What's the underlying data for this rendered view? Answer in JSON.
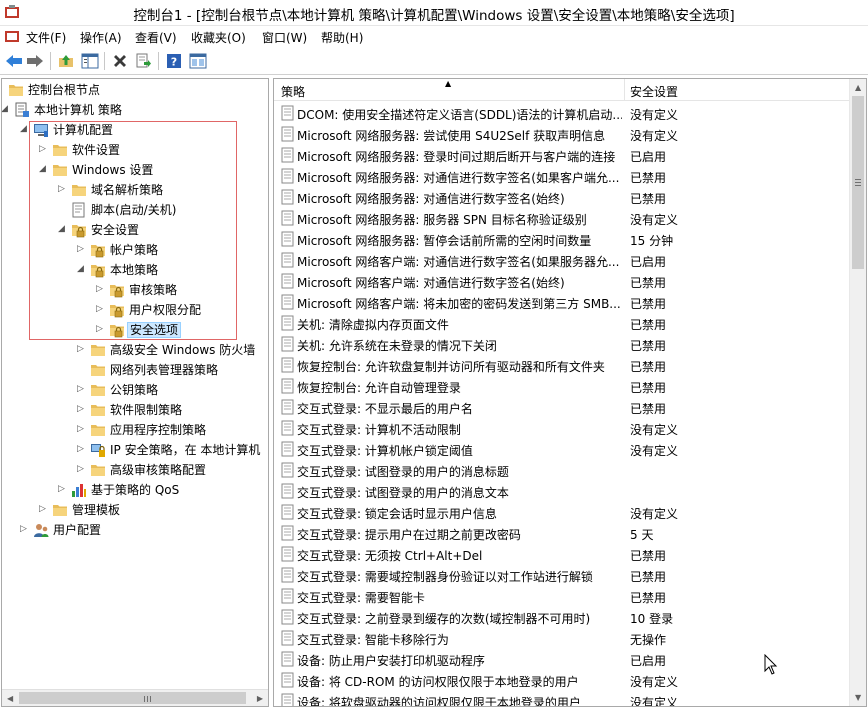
{
  "window": {
    "title": "控制台1 - [控制台根节点\\本地计算机 策略\\计算机配置\\Windows 设置\\安全设置\\本地策略\\安全选项]"
  },
  "menu": [
    "文件(F)",
    "操作(A)",
    "查看(V)",
    "收藏夹(O)",
    "窗口(W)",
    "帮助(H)"
  ],
  "toolbar": {
    "icons": [
      "back-arrow-icon",
      "forward-arrow-icon",
      "up-folder-icon",
      "show-hide-tree-icon",
      "delete-icon",
      "export-list-icon",
      "help-icon",
      "properties-icon"
    ]
  },
  "tree": [
    {
      "label": "控制台根节点",
      "icon": "folder-icon",
      "expander": ""
    },
    {
      "label": "本地计算机 策略",
      "icon": "policy-icon",
      "expander": "open"
    },
    {
      "label": "计算机配置",
      "icon": "computer-icon",
      "expander": "open"
    },
    {
      "label": "软件设置",
      "icon": "folder-icon",
      "expander": "closed"
    },
    {
      "label": "Windows 设置",
      "icon": "folder-icon",
      "expander": "open"
    },
    {
      "label": "域名解析策略",
      "icon": "folder-icon",
      "expander": "closed"
    },
    {
      "label": "脚本(启动/关机)",
      "icon": "script-icon",
      "expander": ""
    },
    {
      "label": "安全设置",
      "icon": "lock-folder-icon",
      "expander": "open"
    },
    {
      "label": "帐户策略",
      "icon": "lock-folder-icon",
      "expander": "closed"
    },
    {
      "label": "本地策略",
      "icon": "lock-folder-icon",
      "expander": "open"
    },
    {
      "label": "审核策略",
      "icon": "lock-folder-icon",
      "expander": "closed"
    },
    {
      "label": "用户权限分配",
      "icon": "lock-folder-icon",
      "expander": "closed"
    },
    {
      "label": "安全选项",
      "icon": "lock-folder-icon",
      "expander": "closed"
    },
    {
      "label": "高级安全 Windows 防火墙",
      "icon": "folder-icon",
      "expander": "closed"
    },
    {
      "label": "网络列表管理器策略",
      "icon": "folder-icon",
      "expander": ""
    },
    {
      "label": "公钥策略",
      "icon": "folder-icon",
      "expander": "closed"
    },
    {
      "label": "软件限制策略",
      "icon": "folder-icon",
      "expander": "closed"
    },
    {
      "label": "应用程序控制策略",
      "icon": "folder-icon",
      "expander": "closed"
    },
    {
      "label": "IP 安全策略，在 本地计算机",
      "icon": "ipsec-icon",
      "expander": "closed"
    },
    {
      "label": "高级审核策略配置",
      "icon": "folder-icon",
      "expander": "closed"
    },
    {
      "label": "基于策略的 QoS",
      "icon": "chart-icon",
      "expander": "closed"
    },
    {
      "label": "管理模板",
      "icon": "folder-icon",
      "expander": "closed"
    },
    {
      "label": "用户配置",
      "icon": "user-icon",
      "expander": "closed"
    }
  ],
  "table": {
    "columns": [
      "策略",
      "安全设置"
    ],
    "rows": [
      {
        "policy": "DCOM: 使用安全描述符定义语言(SDDL)语法的计算机启动...",
        "setting": "没有定义"
      },
      {
        "policy": "Microsoft 网络服务器: 尝试使用 S4U2Self 获取声明信息",
        "setting": "没有定义"
      },
      {
        "policy": "Microsoft 网络服务器: 登录时间过期后断开与客户端的连接",
        "setting": "已启用"
      },
      {
        "policy": "Microsoft 网络服务器: 对通信进行数字签名(如果客户端允...",
        "setting": "已禁用"
      },
      {
        "policy": "Microsoft 网络服务器: 对通信进行数字签名(始终)",
        "setting": "已禁用"
      },
      {
        "policy": "Microsoft 网络服务器: 服务器 SPN 目标名称验证级别",
        "setting": "没有定义"
      },
      {
        "policy": "Microsoft 网络服务器: 暂停会话前所需的空闲时间数量",
        "setting": "15 分钟"
      },
      {
        "policy": "Microsoft 网络客户端: 对通信进行数字签名(如果服务器允...",
        "setting": "已启用"
      },
      {
        "policy": "Microsoft 网络客户端: 对通信进行数字签名(始终)",
        "setting": "已禁用"
      },
      {
        "policy": "Microsoft 网络客户端: 将未加密的密码发送到第三方 SMB...",
        "setting": "已禁用"
      },
      {
        "policy": "关机: 清除虚拟内存页面文件",
        "setting": "已禁用"
      },
      {
        "policy": "关机: 允许系统在未登录的情况下关闭",
        "setting": "已禁用"
      },
      {
        "policy": "恢复控制台: 允许软盘复制并访问所有驱动器和所有文件夹",
        "setting": "已禁用"
      },
      {
        "policy": "恢复控制台: 允许自动管理登录",
        "setting": "已禁用"
      },
      {
        "policy": "交互式登录: 不显示最后的用户名",
        "setting": "已禁用"
      },
      {
        "policy": "交互式登录: 计算机不活动限制",
        "setting": "没有定义"
      },
      {
        "policy": "交互式登录: 计算机帐户锁定阈值",
        "setting": "没有定义"
      },
      {
        "policy": "交互式登录: 试图登录的用户的消息标题",
        "setting": ""
      },
      {
        "policy": "交互式登录: 试图登录的用户的消息文本",
        "setting": ""
      },
      {
        "policy": "交互式登录: 锁定会话时显示用户信息",
        "setting": "没有定义"
      },
      {
        "policy": "交互式登录: 提示用户在过期之前更改密码",
        "setting": "5 天"
      },
      {
        "policy": "交互式登录: 无须按 Ctrl+Alt+Del",
        "setting": "已禁用"
      },
      {
        "policy": "交互式登录: 需要域控制器身份验证以对工作站进行解锁",
        "setting": "已禁用"
      },
      {
        "policy": "交互式登录: 需要智能卡",
        "setting": "已禁用"
      },
      {
        "policy": "交互式登录: 之前登录到缓存的次数(域控制器不可用时)",
        "setting": "10 登录"
      },
      {
        "policy": "交互式登录: 智能卡移除行为",
        "setting": "无操作"
      },
      {
        "policy": "设备: 防止用户安装打印机驱动程序",
        "setting": "已启用"
      },
      {
        "policy": "设备: 将 CD-ROM 的访问权限仅限于本地登录的用户",
        "setting": "没有定义"
      },
      {
        "policy": "设备: 将软盘驱动器的访问权限仅限于本地登录的用户",
        "setting": "没有定义"
      }
    ]
  }
}
